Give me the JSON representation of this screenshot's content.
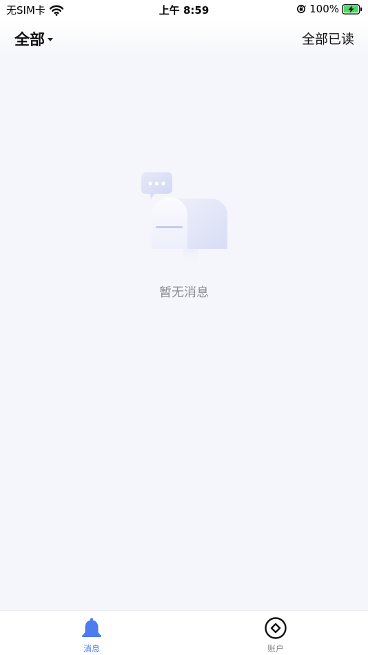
{
  "status_bar": {
    "carrier": "无SIM卡",
    "time": "上午 8:59",
    "battery": "100%"
  },
  "header": {
    "filter_label": "全部",
    "mark_all_read": "全部已读"
  },
  "empty_state": {
    "message": "暂无消息"
  },
  "tab_bar": {
    "active_color": "#4c7cf0",
    "tabs": [
      {
        "label": "消息",
        "icon": "bell-icon",
        "active": true
      },
      {
        "label": "账户",
        "icon": "diamond-circle-icon",
        "active": false
      }
    ]
  }
}
